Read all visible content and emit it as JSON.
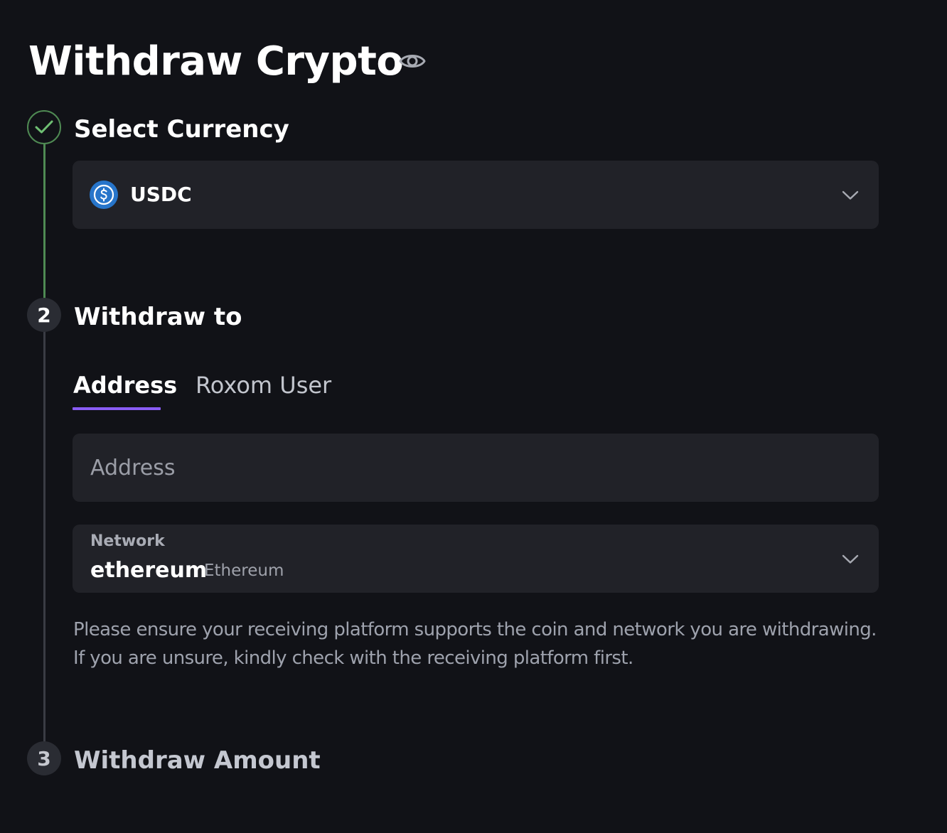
{
  "page": {
    "title": "Withdraw Crypto",
    "visibility_icon": "eye-icon"
  },
  "steps": [
    {
      "number": "1",
      "title": "Select Currency",
      "status": "done",
      "icon": "check-icon"
    },
    {
      "number": "2",
      "title": "Withdraw to",
      "status": "active"
    },
    {
      "number": "3",
      "title": "Withdraw Amount",
      "status": "pending"
    }
  ],
  "currency": {
    "selected": "USDC",
    "icon": "usdc-icon",
    "dropdown_icon": "chevron-down-icon"
  },
  "withdraw_to": {
    "tabs": [
      {
        "label": "Address",
        "active": true
      },
      {
        "label": "Roxom User",
        "active": false
      }
    ],
    "address": {
      "value": "",
      "placeholder": "Address"
    },
    "network": {
      "label": "Network",
      "value": "ethereum",
      "sub_label": "Ethereum",
      "dropdown_icon": "chevron-down-icon"
    },
    "hint_lines": [
      "Please ensure your receiving platform supports the coin and network you are withdrawing.",
      "If you are unsure, kindly check with the receiving platform first."
    ]
  },
  "colors": {
    "background": "#111217",
    "surface": "#212228",
    "accent_tab": "#8a5cf5",
    "step_done": "#4f8a53",
    "usdc_blue": "#2775ca"
  }
}
